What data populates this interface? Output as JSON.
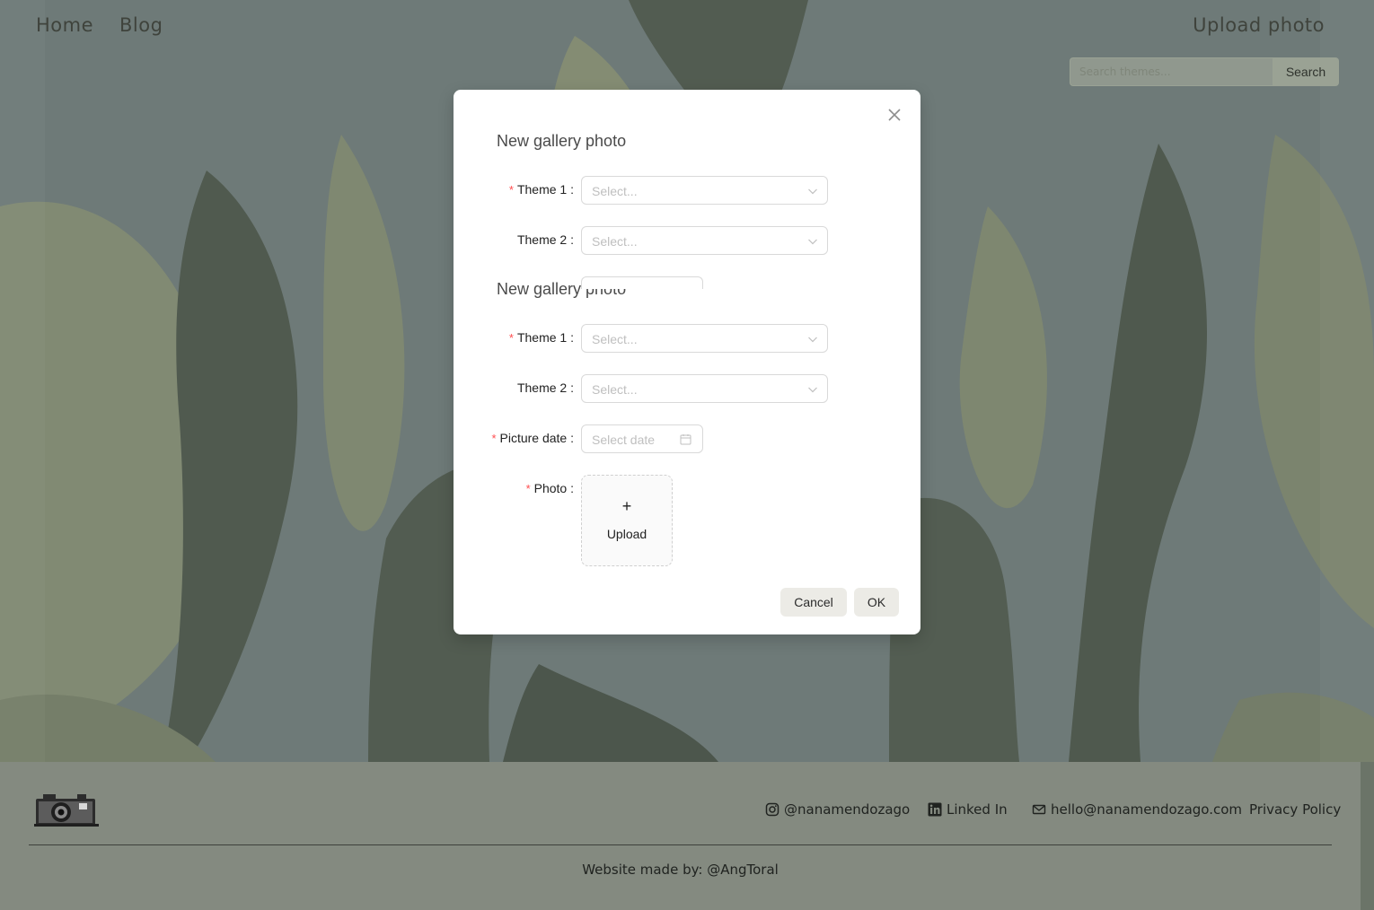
{
  "header": {
    "nav_home": "Home",
    "nav_blog": "Blog",
    "upload_photo": "Upload photo",
    "search_placeholder": "Search themes...",
    "search_button": "Search"
  },
  "modal": {
    "title_1": "New gallery photo",
    "title_2": "New gallery photo",
    "theme1_label": "Theme 1",
    "theme2_label": "Theme 2",
    "picture_date_label": "Picture date",
    "photo_label": "Photo",
    "colon": ":",
    "required_mark": "*",
    "select_placeholder": "Select...",
    "date_placeholder": "Select date",
    "upload_plus": "+",
    "upload_label": "Upload",
    "cancel_button": "Cancel",
    "ok_button": "OK"
  },
  "footer": {
    "instagram": "@nanamendozago",
    "linkedin": "Linked In",
    "email": "hello@nanamendozago.com",
    "privacy": "Privacy Policy",
    "credit": "Website made by:  @AngToral"
  },
  "colors": {
    "required": "#ff4d4f",
    "modal_bg": "#ffffff",
    "footer_bg": "#848a80",
    "button_bg": "#ecebe6"
  }
}
